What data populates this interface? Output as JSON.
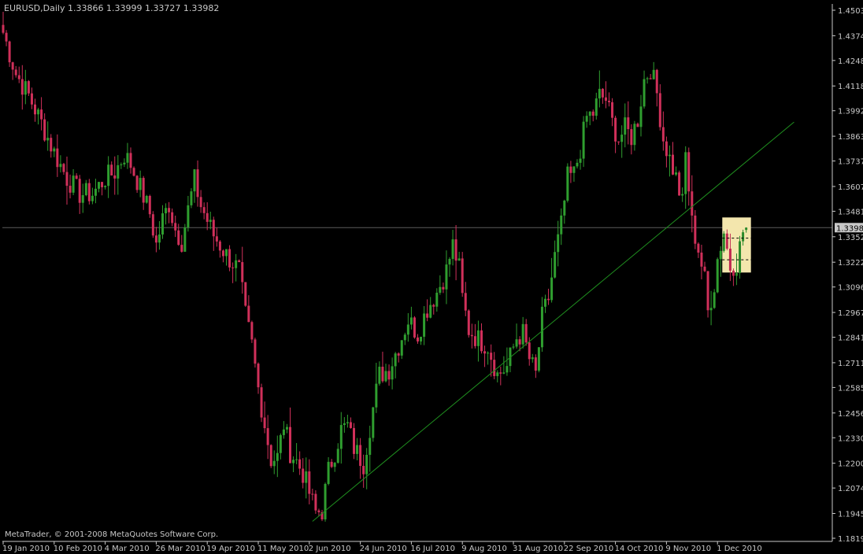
{
  "chart_data": {
    "type": "candlestick",
    "title": "EURUSD,Daily  1.33866 1.33999 1.33727 1.33982",
    "symbol": "EURUSD,Daily",
    "ohlc": {
      "open": 1.33866,
      "high": 1.33999,
      "low": 1.33727,
      "close": 1.33982
    },
    "current_price_label": "1.33982",
    "watermark": "MetaTrader, © 2001-2008 MetaQuotes Software Corp.",
    "y_ticks": [
      "1.45035",
      "1.43740",
      "1.42480",
      "1.41185",
      "1.39925",
      "1.38630",
      "1.37370",
      "1.36075",
      "1.34815",
      "1.33520",
      "1.32225",
      "1.30965",
      "1.29670",
      "1.28410",
      "1.27115",
      "1.25855",
      "1.24560",
      "1.23300",
      "1.22005",
      "1.20745",
      "1.19450",
      "1.18190"
    ],
    "ylim": [
      1.1819,
      1.45035
    ],
    "x_ticks": [
      "19 Jan 2010",
      "10 Feb 2010",
      "4 Mar 2010",
      "26 Mar 2010",
      "19 Apr 2010",
      "11 May 2010",
      "2 Jun 2010",
      "24 Jun 2010",
      "16 Jul 2010",
      "9 Aug 2010",
      "31 Aug 2010",
      "22 Sep 2010",
      "14 Oct 2010",
      "9 Nov 2010",
      "1 Dec 2010"
    ],
    "x_tick_index": [
      0,
      16,
      32,
      48,
      64,
      80,
      96,
      112,
      128,
      144,
      160,
      176,
      192,
      208,
      224
    ],
    "bar_count": 234,
    "close_path": [
      [
        0,
        1.439
      ],
      [
        4,
        1.418
      ],
      [
        8,
        1.407
      ],
      [
        12,
        1.393
      ],
      [
        16,
        1.378
      ],
      [
        20,
        1.365
      ],
      [
        24,
        1.357
      ],
      [
        28,
        1.357
      ],
      [
        32,
        1.365
      ],
      [
        35,
        1.368
      ],
      [
        38,
        1.377
      ],
      [
        40,
        1.372
      ],
      [
        43,
        1.36
      ],
      [
        46,
        1.347
      ],
      [
        48,
        1.331
      ],
      [
        50,
        1.344
      ],
      [
        52,
        1.352
      ],
      [
        54,
        1.339
      ],
      [
        56,
        1.333
      ],
      [
        58,
        1.349
      ],
      [
        60,
        1.364
      ],
      [
        62,
        1.351
      ],
      [
        66,
        1.336
      ],
      [
        70,
        1.326
      ],
      [
        72,
        1.322
      ],
      [
        74,
        1.318
      ],
      [
        76,
        1.295
      ],
      [
        78,
        1.28
      ],
      [
        80,
        1.258
      ],
      [
        82,
        1.24
      ],
      [
        84,
        1.222
      ],
      [
        86,
        1.223
      ],
      [
        88,
        1.24
      ],
      [
        90,
        1.226
      ],
      [
        92,
        1.221
      ],
      [
        94,
        1.215
      ],
      [
        96,
        1.205
      ],
      [
        98,
        1.195
      ],
      [
        100,
        1.196
      ],
      [
        102,
        1.216
      ],
      [
        104,
        1.226
      ],
      [
        106,
        1.237
      ],
      [
        108,
        1.239
      ],
      [
        110,
        1.228
      ],
      [
        113,
        1.22
      ],
      [
        116,
        1.248
      ],
      [
        118,
        1.265
      ],
      [
        121,
        1.268
      ],
      [
        124,
        1.28
      ],
      [
        127,
        1.293
      ],
      [
        130,
        1.286
      ],
      [
        133,
        1.299
      ],
      [
        136,
        1.307
      ],
      [
        139,
        1.318
      ],
      [
        141,
        1.331
      ],
      [
        143,
        1.319
      ],
      [
        144,
        1.304
      ],
      [
        146,
        1.288
      ],
      [
        149,
        1.283
      ],
      [
        152,
        1.28
      ],
      [
        155,
        1.265
      ],
      [
        158,
        1.269
      ],
      [
        161,
        1.284
      ],
      [
        163,
        1.286
      ],
      [
        165,
        1.273
      ],
      [
        167,
        1.265
      ],
      [
        169,
        1.294
      ],
      [
        171,
        1.304
      ],
      [
        173,
        1.325
      ],
      [
        175,
        1.341
      ],
      [
        177,
        1.365
      ],
      [
        179,
        1.367
      ],
      [
        181,
        1.38
      ],
      [
        183,
        1.396
      ],
      [
        185,
        1.398
      ],
      [
        187,
        1.407
      ],
      [
        189,
        1.405
      ],
      [
        191,
        1.393
      ],
      [
        193,
        1.385
      ],
      [
        195,
        1.39
      ],
      [
        197,
        1.386
      ],
      [
        199,
        1.395
      ],
      [
        201,
        1.415
      ],
      [
        203,
        1.421
      ],
      [
        205,
        1.408
      ],
      [
        207,
        1.385
      ],
      [
        209,
        1.375
      ],
      [
        211,
        1.365
      ],
      [
        213,
        1.352
      ],
      [
        214,
        1.377
      ],
      [
        216,
        1.342
      ],
      [
        218,
        1.329
      ],
      [
        220,
        1.313
      ],
      [
        221,
        1.297
      ],
      [
        223,
        1.311
      ],
      [
        224,
        1.324
      ],
      [
        226,
        1.338
      ],
      [
        228,
        1.32
      ],
      [
        230,
        1.322
      ],
      [
        232,
        1.338
      ],
      [
        233,
        1.33982
      ]
    ],
    "trendline": {
      "from_index": 97,
      "from_value": 1.1905,
      "to_index": 248,
      "to_value": 1.3935
    },
    "highlight_box": {
      "from_index": 226,
      "to_index": 234,
      "top_value": 1.345,
      "bottom_value": 1.317
    },
    "dashed_levels": [
      1.3345,
      1.3235
    ],
    "grid": false,
    "colors": {
      "background": "#000000",
      "bull": "#2f9e2f",
      "bear": "#d0305a",
      "axis": "#c8c8c8",
      "text": "#c8c8c8",
      "trendline": "#1f8f1f",
      "highlight": "#f3e6ad",
      "price_label_bg": "#c8c8c8",
      "price_label_text": "#000000",
      "bid_line": "#5a5a5a"
    }
  }
}
